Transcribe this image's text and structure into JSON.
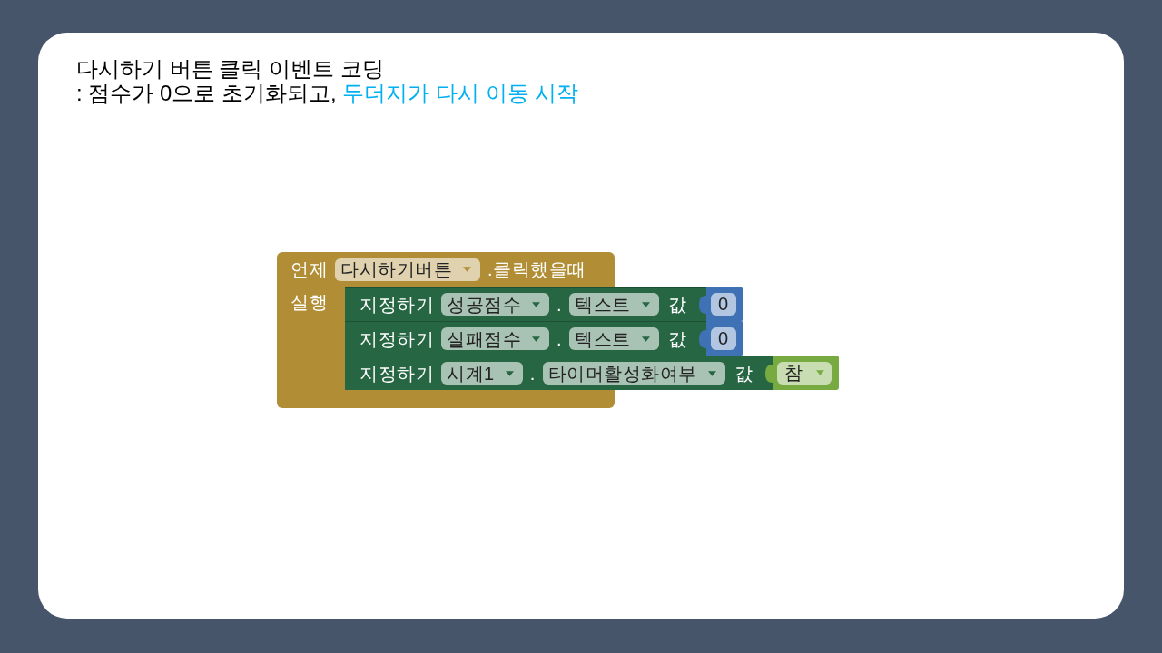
{
  "heading": {
    "title": "다시하기 버튼 클릭 이벤트 코딩",
    "subtitle": [
      {
        "text": ": 점수가 0으로 초기화되고, ",
        "highlighted": false
      },
      {
        "text": "두더지가 다시 이동 시작",
        "highlighted": true
      }
    ]
  },
  "event_block": {
    "keyword": "언제",
    "component": "다시하기버튼",
    "event": ".클릭했을때",
    "do_label": "실행",
    "statements": [
      {
        "keyword": "지정하기",
        "component": "성공점수",
        "separator": ".",
        "property": "텍스트",
        "value_label": "값",
        "value": {
          "kind": "number",
          "text": "0"
        }
      },
      {
        "keyword": "지정하기",
        "component": "실패점수",
        "separator": ".",
        "property": "텍스트",
        "value_label": "값",
        "value": {
          "kind": "number",
          "text": "0"
        }
      },
      {
        "keyword": "지정하기",
        "component": "시계1",
        "separator": ".",
        "property": "타이머활성화여부",
        "value_label": "값",
        "value": {
          "kind": "logic",
          "text": "참"
        }
      }
    ]
  }
}
